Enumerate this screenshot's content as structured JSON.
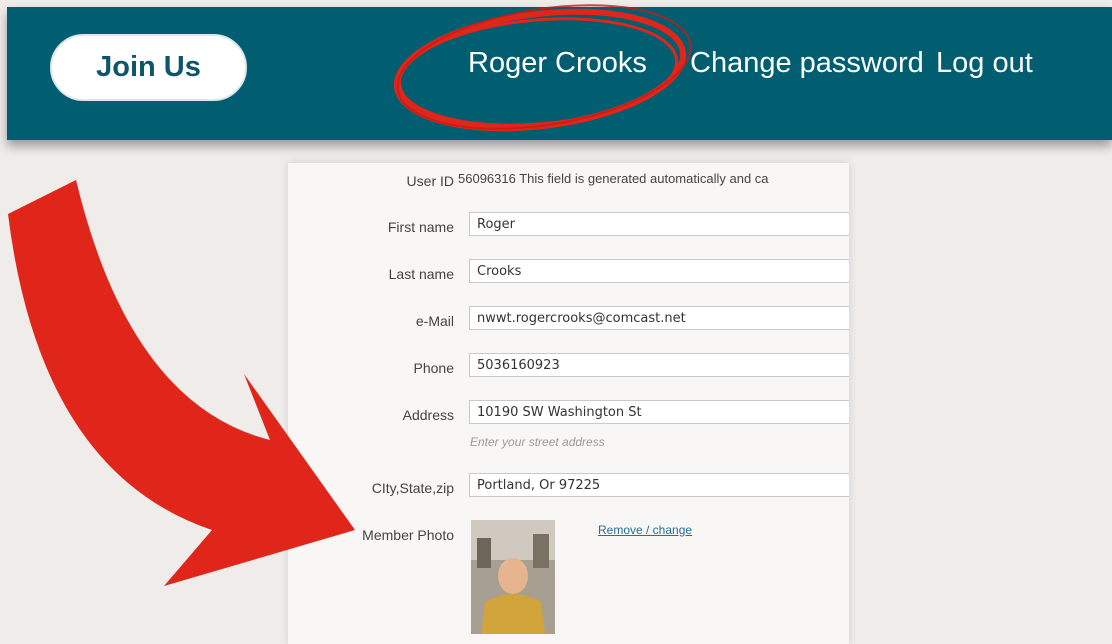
{
  "nav": {
    "join_label": "Join Us",
    "user_name": "Roger Crooks",
    "change_password": "Change password",
    "logout": "Log out"
  },
  "form": {
    "user_id_label": "User ID",
    "user_id_value": "56096316 This field is generated automatically and ca",
    "first_name_label": "First name",
    "first_name_value": "Roger",
    "last_name_label": "Last name",
    "last_name_value": "Crooks",
    "email_label": "e-Mail",
    "email_value": "nwwt.rogercrooks@comcast.net",
    "phone_label": "Phone",
    "phone_value": "5036160923",
    "address_label": "Address",
    "address_value": "10190 SW Washington St",
    "address_hint": "Enter your street address",
    "city_label": "CIty,State,zip",
    "city_value": "Portland, Or 97225",
    "photo_label": "Member Photo",
    "photo_action": "Remove / change"
  },
  "colors": {
    "nav_background": "#005e70",
    "annotation_red": "#e0261a"
  }
}
